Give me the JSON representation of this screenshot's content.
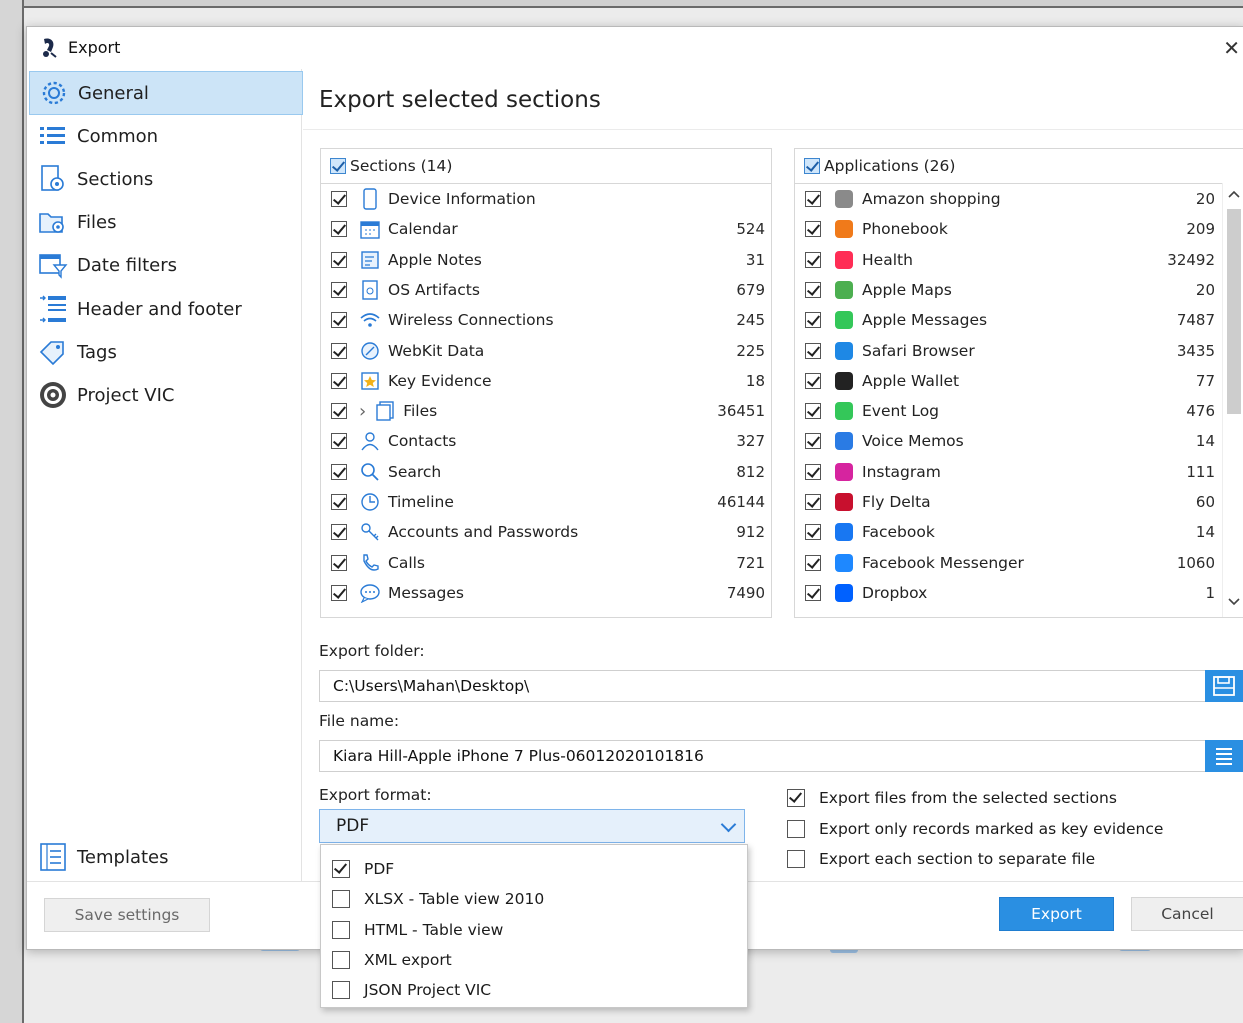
{
  "window": {
    "title": "Export",
    "close_glyph": "✕"
  },
  "sidebar": {
    "items": [
      {
        "label": "General",
        "icon": "gear-icon",
        "active": true
      },
      {
        "label": "Common",
        "icon": "list-icon"
      },
      {
        "label": "Sections",
        "icon": "sections-icon"
      },
      {
        "label": "Files",
        "icon": "files-icon"
      },
      {
        "label": "Date filters",
        "icon": "calendar-filter-icon"
      },
      {
        "label": "Header and footer",
        "icon": "header-footer-icon"
      },
      {
        "label": "Tags",
        "icon": "tags-icon"
      },
      {
        "label": "Project VIC",
        "icon": "project-vic-icon"
      }
    ],
    "bottom_item": {
      "label": "Templates",
      "icon": "templates-icon"
    }
  },
  "main": {
    "title": "Export selected sections"
  },
  "sections_panel": {
    "header": "Sections (14)",
    "rows": [
      {
        "label": "Device Information",
        "count": "",
        "icon": "phone-icon"
      },
      {
        "label": "Calendar",
        "count": "524",
        "icon": "calendar-icon"
      },
      {
        "label": "Apple Notes",
        "count": "31",
        "icon": "notes-icon"
      },
      {
        "label": "OS Artifacts",
        "count": "679",
        "icon": "artifacts-icon"
      },
      {
        "label": "Wireless Connections",
        "count": "245",
        "icon": "wifi-icon"
      },
      {
        "label": "WebKit Data",
        "count": "225",
        "icon": "webkit-icon"
      },
      {
        "label": "Key Evidence",
        "count": "18",
        "icon": "key-evidence-icon"
      },
      {
        "label": "Files",
        "count": "36451",
        "icon": "files-icon",
        "expander": "›"
      },
      {
        "label": "Contacts",
        "count": "327",
        "icon": "contacts-icon"
      },
      {
        "label": "Search",
        "count": "812",
        "icon": "search-icon"
      },
      {
        "label": "Timeline",
        "count": "46144",
        "icon": "timeline-icon"
      },
      {
        "label": "Accounts and Passwords",
        "count": "912",
        "icon": "key-icon"
      },
      {
        "label": "Calls",
        "count": "721",
        "icon": "phone-call-icon"
      },
      {
        "label": "Messages",
        "count": "7490",
        "icon": "message-icon"
      }
    ]
  },
  "applications_panel": {
    "header": "Applications (26)",
    "rows": [
      {
        "label": "Amazon shopping",
        "count": "20",
        "color": "#8a8a8a"
      },
      {
        "label": "Phonebook",
        "count": "209",
        "color": "#f07a1a"
      },
      {
        "label": "Health",
        "count": "32492",
        "color": "#ff2d55"
      },
      {
        "label": "Apple Maps",
        "count": "20",
        "color": "#4caf50"
      },
      {
        "label": "Apple Messages",
        "count": "7487",
        "color": "#34c759"
      },
      {
        "label": "Safari Browser",
        "count": "3435",
        "color": "#1e88e5"
      },
      {
        "label": "Apple Wallet",
        "count": "77",
        "color": "#222222"
      },
      {
        "label": "Event Log",
        "count": "476",
        "color": "#34c759"
      },
      {
        "label": "Voice Memos",
        "count": "14",
        "color": "#2a7be4"
      },
      {
        "label": "Instagram",
        "count": "111",
        "color": "#d6249f"
      },
      {
        "label": "Fly Delta",
        "count": "60",
        "color": "#c8102e"
      },
      {
        "label": "Facebook",
        "count": "14",
        "color": "#1877f2"
      },
      {
        "label": "Facebook Messenger",
        "count": "1060",
        "color": "#1e88ff"
      },
      {
        "label": "Dropbox",
        "count": "1",
        "color": "#0061ff"
      }
    ]
  },
  "export_folder": {
    "label": "Export folder:",
    "value": "C:\\Users\\Mahan\\Desktop\\"
  },
  "file_name": {
    "label": "File name:",
    "value": "Kiara Hill-Apple iPhone 7 Plus-06012020101816"
  },
  "export_format": {
    "label": "Export format:",
    "selected": "PDF",
    "options": [
      {
        "label": "PDF",
        "checked": true
      },
      {
        "label": "XLSX - Table view 2010",
        "checked": false
      },
      {
        "label": "HTML - Table view",
        "checked": false
      },
      {
        "label": "XML export",
        "checked": false
      },
      {
        "label": "JSON Project VIC",
        "checked": false
      }
    ]
  },
  "options": [
    {
      "label": "Export files from the selected sections",
      "checked": true
    },
    {
      "label": "Export only records marked as key evidence",
      "checked": false
    },
    {
      "label": "Export each section to separate file",
      "checked": false
    }
  ],
  "buttons": {
    "save": "Save settings",
    "export": "Export",
    "cancel": "Cancel"
  },
  "colors": {
    "accent": "#2a8fe2",
    "nav_active": "#cce4f7"
  }
}
